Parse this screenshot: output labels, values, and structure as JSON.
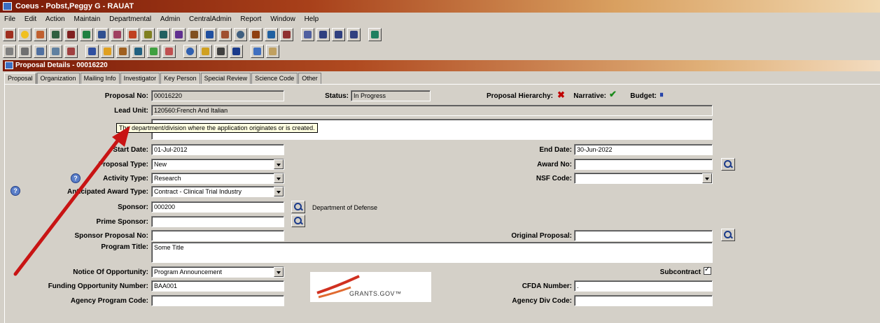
{
  "window": {
    "title": "Coeus - Pobst,Peggy G - RAUAT"
  },
  "menu": [
    "File",
    "Edit",
    "Action",
    "Maintain",
    "Departmental",
    "Admin",
    "CentralAdmin",
    "Report",
    "Window",
    "Help"
  ],
  "subwindow": {
    "title": "Proposal Details - 00016220"
  },
  "tabs": [
    "Proposal",
    "Organization",
    "Mailing Info",
    "Investigator",
    "Key Person",
    "Special Review",
    "Science Code",
    "Other"
  ],
  "form": {
    "proposal_no_label": "Proposal No:",
    "proposal_no": "00016220",
    "status_label": "Status:",
    "status": "In Progress",
    "hierarchy_label": "Proposal Hierarchy:",
    "narrative_label": "Narrative:",
    "budget_label": "Budget:",
    "lead_unit_label": "Lead Unit:",
    "lead_unit": "120560:French And Italian",
    "tooltip": "The department/division where the application originates or is created.",
    "start_date_label": "Start Date:",
    "start_date": "01-Jul-2012",
    "end_date_label": "End Date:",
    "end_date": "30-Jun-2022",
    "proposal_type_label": "Proposal Type:",
    "proposal_type": "New",
    "award_no_label": "Award No:",
    "award_no": "",
    "activity_type_label": "Activity Type:",
    "activity_type": "Research",
    "nsf_code_label": "NSF Code:",
    "nsf_code": "",
    "anticipated_award_label": "Anticipated Award Type:",
    "anticipated_award": "Contract - Clinical Trial Industry",
    "sponsor_label": "Sponsor:",
    "sponsor": "000200",
    "sponsor_name": "Department of Defense",
    "prime_sponsor_label": "Prime Sponsor:",
    "prime_sponsor": "",
    "sponsor_proposal_label": "Sponsor Proposal No:",
    "sponsor_proposal": "",
    "original_proposal_label": "Original Proposal:",
    "original_proposal": "",
    "program_title_label": "Program Title:",
    "program_title": "Some Title",
    "notice_label": "Notice Of Opportunity:",
    "notice": "Program Announcement",
    "subcontract_label": "Subcontract",
    "funding_label": "Funding Opportunity Number:",
    "funding": "BAA001",
    "cfda_label": "CFDA Number:",
    "cfda": ".",
    "agency_program_label": "Agency Program Code:",
    "agency_program": "",
    "agency_div_label": "Agency Div Code:",
    "agency_div": ""
  },
  "logo_text": "GRANTS.GOV™",
  "colors": {
    "title_bar": "#7a1a08",
    "arrow": "#c81414",
    "form_bg": "#d4d0c8"
  }
}
